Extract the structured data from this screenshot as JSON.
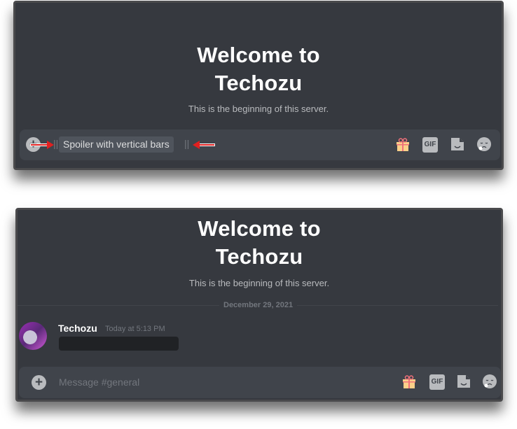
{
  "top_panel": {
    "welcome_line1": "Welcome to",
    "welcome_line2": "Techozu",
    "subtitle": "This is the beginning of this server.",
    "composer": {
      "plus_icon": "+",
      "bar_open": "||",
      "spoiler_text": "Spoiler with vertical bars",
      "bar_close": "||",
      "annotation_arrows": [
        "arrow-right",
        "arrow-left"
      ],
      "annotation_color": "#e02020",
      "icons": [
        "gift-icon",
        "gif-icon",
        "sticker-icon",
        "emoji-icon"
      ],
      "gif_label": "GIF"
    }
  },
  "bottom_panel": {
    "welcome_line1": "Welcome to",
    "welcome_line2": "Techozu",
    "subtitle": "This is the beginning of this server.",
    "date_divider": "December 29, 2021",
    "message": {
      "username": "Techozu",
      "timestamp": "Today at 5:13 PM",
      "content": "[spoiler hidden]"
    },
    "composer": {
      "plus_icon": "+",
      "placeholder": "Message #general",
      "icons": [
        "gift-icon",
        "gif-icon",
        "sticker-icon",
        "emoji-icon"
      ],
      "gif_label": "GIF"
    }
  },
  "colors": {
    "background": "#36393f",
    "composer": "#40444b",
    "spoiler_hidden": "#202225",
    "muted_text": "#72767d"
  }
}
